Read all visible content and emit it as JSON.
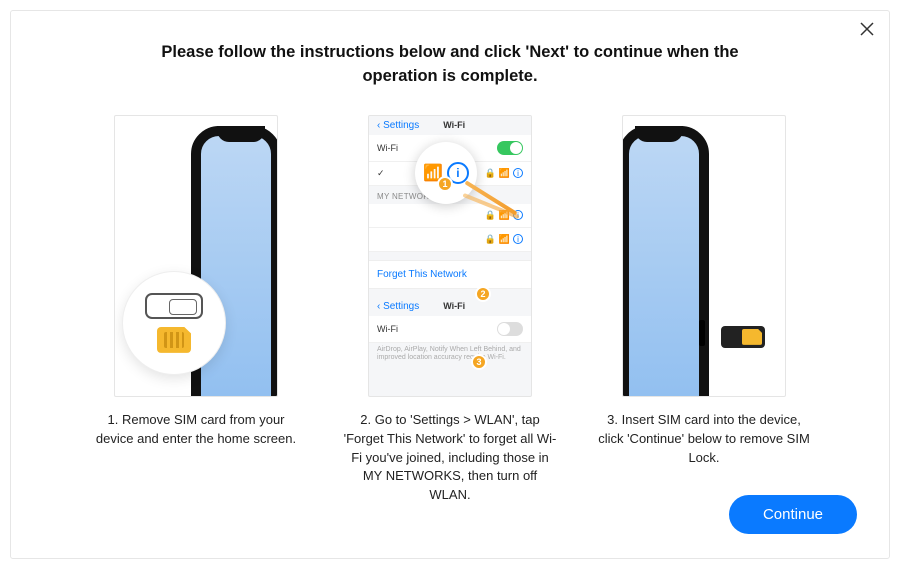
{
  "title": "Please follow the instructions below and click 'Next' to continue when the operation is complete.",
  "steps": {
    "s1": "1. Remove SIM card from your device and enter the home screen.",
    "s2": "2. Go to 'Settings > WLAN', tap 'Forget This Network' to forget all Wi-Fi you've joined, including those in MY NETWORKS, then turn off WLAN.",
    "s3": "3. Insert SIM card  into the device, click 'Continue' below to remove SIM Lock."
  },
  "wifi": {
    "back": "Settings",
    "header": "Wi-Fi",
    "wifi_label": "Wi-Fi",
    "my_networks": "MY NETWORKS",
    "forget": "Forget This Network",
    "fineprint": "AirDrop, AirPlay, Notify When Left Behind, and improved location accuracy require Wi-Fi."
  },
  "badges": {
    "b1": "1",
    "b2": "2",
    "b3": "3"
  },
  "buttons": {
    "continue": "Continue"
  }
}
